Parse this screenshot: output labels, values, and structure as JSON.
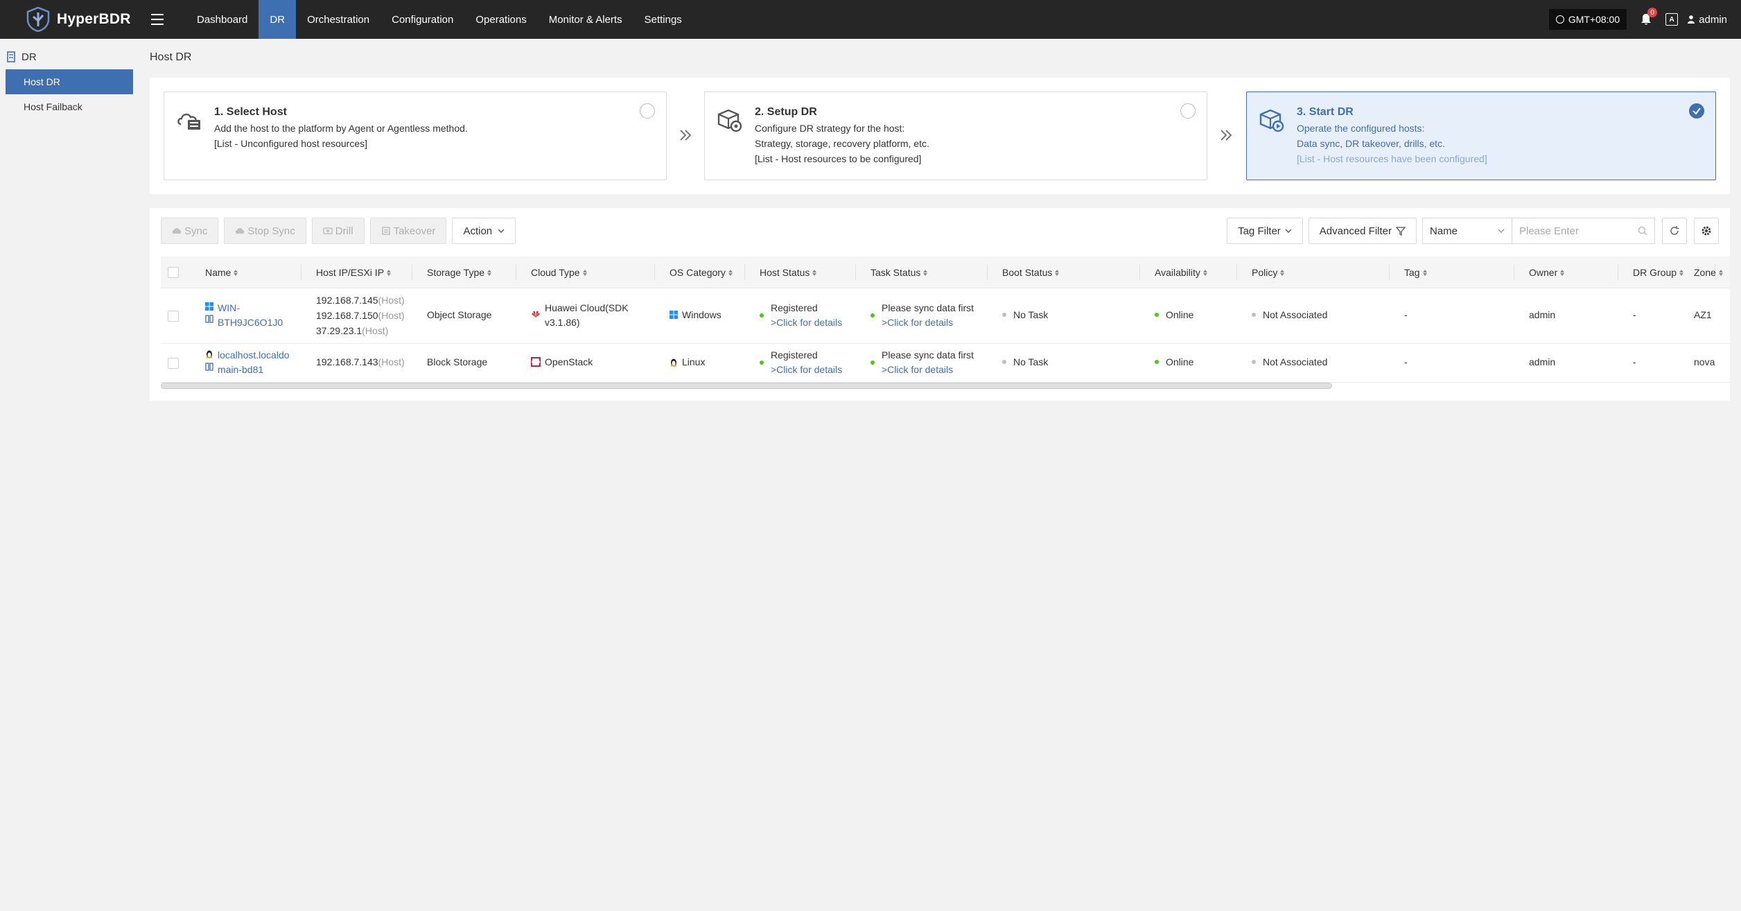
{
  "app": {
    "name": "HyperBDR"
  },
  "nav": {
    "items": [
      "Dashboard",
      "DR",
      "Orchestration",
      "Configuration",
      "Operations",
      "Monitor & Alerts",
      "Settings"
    ],
    "active": "DR"
  },
  "header": {
    "timezone": "GMT+08:00",
    "notifications": "0",
    "lang_label": "A",
    "user": "admin"
  },
  "sidebar": {
    "group": "DR",
    "items": [
      {
        "label": "Host DR",
        "active": true
      },
      {
        "label": "Host Failback",
        "active": false
      }
    ]
  },
  "page": {
    "title": "Host DR"
  },
  "steps": [
    {
      "title": "1. Select Host",
      "lines": [
        "Add the host to the platform by Agent or Agentless method.",
        "[List - Unconfigured host resources]"
      ],
      "done": false
    },
    {
      "title": "2. Setup DR",
      "lines": [
        "Configure DR strategy for the host:",
        "Strategy, storage, recovery platform, etc.",
        "[List - Host resources to be configured]"
      ],
      "done": false
    },
    {
      "title": "3. Start DR",
      "lines": [
        "Operate the configured hosts:",
        "Data sync, DR takeover, drills, etc.",
        "[List - Host resources have been configured]"
      ],
      "done": true
    }
  ],
  "toolbar": {
    "sync": "Sync",
    "stop_sync": "Stop Sync",
    "drill": "Drill",
    "takeover": "Takeover",
    "action": "Action",
    "tag_filter": "Tag Filter",
    "advanced_filter": "Advanced Filter",
    "search_field": "Name",
    "search_placeholder": "Please Enter"
  },
  "table": {
    "columns": [
      "Name",
      "Host IP/ESXi IP",
      "Storage Type",
      "Cloud Type",
      "OS Category",
      "Host Status",
      "Task Status",
      "Boot Status",
      "Availability",
      "Policy",
      "Tag",
      "Owner",
      "DR Group",
      "Zone"
    ],
    "rows": [
      {
        "name_lines": [
          "WIN-",
          "BTH9JC6O1J0"
        ],
        "ips": [
          {
            "ip": "192.168.7.145",
            "kind": "(Host)"
          },
          {
            "ip": "192.168.7.150",
            "kind": "(Host)"
          },
          {
            "ip": "37.29.23.1",
            "kind": "(Host)"
          }
        ],
        "storage_type": "Object Storage",
        "cloud_type_lines": [
          "Huawei Cloud(SDK",
          "v3.1.86)"
        ],
        "os": "Windows",
        "host_status": "Registered",
        "host_status_link": ">Click for details",
        "task_status": "Please sync data first",
        "task_status_link": ">Click for details",
        "boot_status": "No Task",
        "availability": "Online",
        "policy": "Not Associated",
        "tag": "-",
        "owner": "admin",
        "dr_group": "-",
        "zone": "AZ1"
      },
      {
        "name_lines": [
          "localhost.localdo",
          "main-bd81"
        ],
        "ips": [
          {
            "ip": "192.168.7.143",
            "kind": "(Host)"
          }
        ],
        "storage_type": "Block Storage",
        "cloud_type_lines": [
          "OpenStack"
        ],
        "os": "Linux",
        "host_status": "Registered",
        "host_status_link": ">Click for details",
        "task_status": "Please sync data first",
        "task_status_link": ">Click for details",
        "boot_status": "No Task",
        "availability": "Online",
        "policy": "Not Associated",
        "tag": "-",
        "owner": "admin",
        "dr_group": "-",
        "zone": "nova"
      }
    ]
  },
  "colors": {
    "accent": "#3e6fb1",
    "topbar": "#262626",
    "online": "#52c41a",
    "huawei": "#e0282a",
    "openstack": "#da1a32",
    "windows": "#1e90ff"
  }
}
